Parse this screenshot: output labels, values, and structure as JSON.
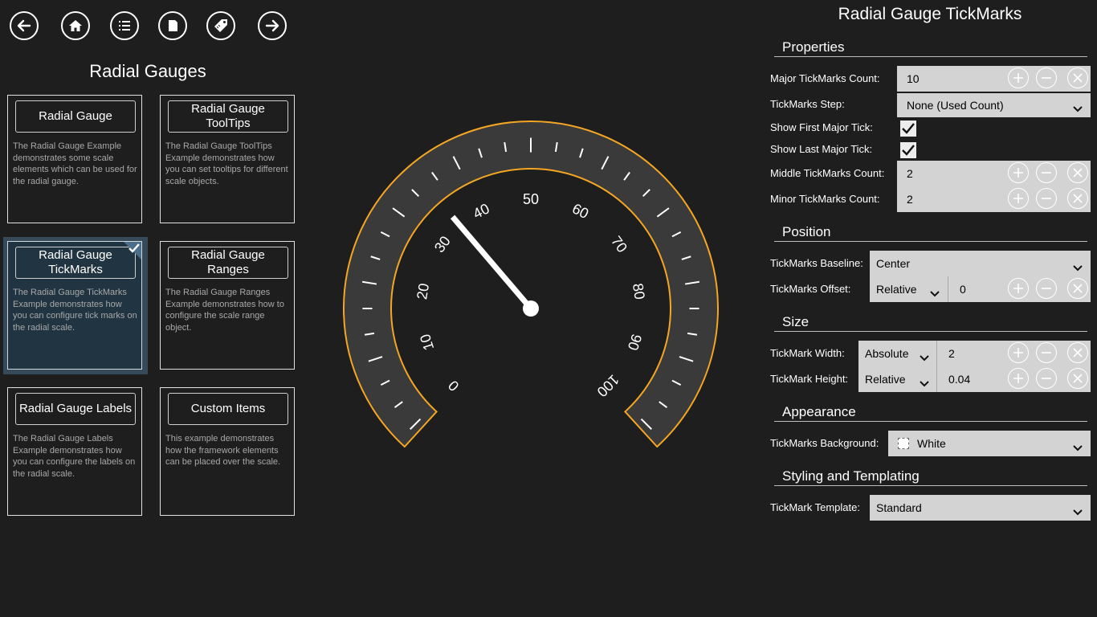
{
  "nav": {
    "buttons": [
      "back",
      "home",
      "list",
      "page",
      "tag",
      "forward"
    ]
  },
  "left": {
    "title": "Radial Gauges",
    "tiles": [
      {
        "label": "Radial Gauge",
        "desc": "The Radial Gauge Example demonstrates some scale elements which can be used for the radial gauge."
      },
      {
        "label": "Radial Gauge ToolTips",
        "desc": "The Radial Gauge ToolTips Example demonstrates how you can set tooltips for different scale objects."
      },
      {
        "label": "Radial Gauge TickMarks",
        "desc": "The Radial Gauge TickMarks Example demonstrates how you can configure tick marks on the radial scale."
      },
      {
        "label": "Radial Gauge Ranges",
        "desc": "The Radial Gauge Ranges Example demonstrates how to configure the scale range object."
      },
      {
        "label": "Radial Gauge Labels",
        "desc": "The Radial Gauge Labels Example demonstrates how you can configure the labels on the radial scale."
      },
      {
        "label": "Custom Items",
        "desc": "This example demonstrates how the framework elements can be placed over the scale."
      }
    ],
    "selected_index": 2
  },
  "gauge": {
    "labels": [
      "0",
      "10",
      "20",
      "30",
      "40",
      "50",
      "60",
      "70",
      "80",
      "90",
      "100"
    ],
    "needle_value": 35,
    "min": 0,
    "max": 100,
    "accent_color": "#f5a623",
    "band_color": "#3a3a3a"
  },
  "panel": {
    "title": "Radial Gauge TickMarks",
    "groups": {
      "properties": "Properties",
      "position": "Position",
      "size": "Size",
      "appearance": "Appearance",
      "styling": "Styling and Templating"
    },
    "major_count": {
      "label": "Major TickMarks Count:",
      "value": "10"
    },
    "step": {
      "label": "TickMarks Step:",
      "value": "None (Used Count)"
    },
    "show_first": {
      "label": "Show First Major Tick:",
      "checked": true
    },
    "show_last": {
      "label": "Show Last Major Tick:",
      "checked": true
    },
    "middle_count": {
      "label": "Middle TickMarks Count:",
      "value": "2"
    },
    "minor_count": {
      "label": "Minor TickMarks Count:",
      "value": "2"
    },
    "baseline": {
      "label": "TickMarks Baseline:",
      "value": "Center"
    },
    "offset": {
      "label": "TickMarks Offset:",
      "unit": "Relative",
      "value": "0"
    },
    "width": {
      "label": "TickMark Width:",
      "unit": "Absolute",
      "value": "2"
    },
    "height": {
      "label": "TickMark Height:",
      "unit": "Relative",
      "value": "0.04"
    },
    "background": {
      "label": "TickMarks Background:",
      "value": "White"
    },
    "template": {
      "label": "TickMark Template:",
      "value": "Standard"
    }
  }
}
